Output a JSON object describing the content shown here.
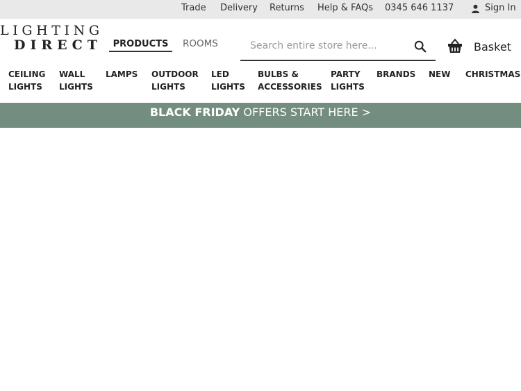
{
  "topbar": {
    "links": [
      "Trade",
      "Delivery",
      "Returns",
      "Help & FAQs",
      "0345 646 1137"
    ],
    "signin": "Sign In",
    "user_icon": "user-icon"
  },
  "logo": {
    "line1": "LIGHTING",
    "line2": "DIRECT"
  },
  "tabs": {
    "products": "PRODUCTS",
    "rooms": "ROOMS",
    "active": "PRODUCTS"
  },
  "search": {
    "placeholder": "Search entire store here...",
    "value": "",
    "icon": "search-icon"
  },
  "basket": {
    "label": "Basket",
    "icon": "basket-icon"
  },
  "nav": {
    "items": [
      [
        "CEILING",
        "LIGHTS"
      ],
      [
        "WALL",
        "LIGHTS"
      ],
      [
        "LAMPS"
      ],
      [
        "OUTDOOR",
        "LIGHTS"
      ],
      [
        "LED",
        "LIGHTS"
      ],
      [
        "BULBS &",
        "ACCESSORIES"
      ],
      [
        "PARTY",
        "LIGHTS"
      ],
      [
        "BRANDS"
      ],
      [
        "NEW"
      ],
      [
        "CHRISTMAS"
      ]
    ]
  },
  "promo": {
    "bold": "BLACK FRIDAY",
    "text": " OFFERS START HERE >",
    "color": "#738e81"
  }
}
